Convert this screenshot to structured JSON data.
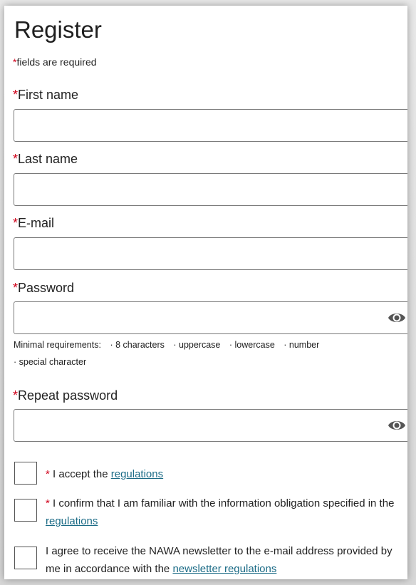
{
  "form": {
    "title": "Register",
    "required_star": "*",
    "required_note": "fields are required",
    "fields": {
      "first_name": {
        "label": "First name",
        "value": "",
        "placeholder": ""
      },
      "last_name": {
        "label": "Last name",
        "value": "",
        "placeholder": ""
      },
      "email": {
        "label": "E-mail",
        "value": "",
        "placeholder": ""
      },
      "password": {
        "label": "Password",
        "value": "",
        "placeholder": ""
      },
      "repeat_password": {
        "label": "Repeat password",
        "value": "",
        "placeholder": ""
      }
    },
    "password_requirements": {
      "intro": "Minimal requirements:",
      "items": [
        "· 8 characters",
        "· uppercase",
        "· lowercase",
        "· number",
        "· special character"
      ]
    },
    "checkboxes": {
      "regulations": {
        "checked": false,
        "text": "I accept the ",
        "link": "regulations"
      },
      "information": {
        "checked": false,
        "text": "I confirm that I am familiar with the information obligation specified in the ",
        "link": "regulations"
      },
      "newsletter": {
        "checked": false,
        "text": "I agree to receive the NAWA newsletter to the e-mail address provided by me in accordance with the ",
        "link": "newsletter regulations"
      }
    }
  },
  "icons": {
    "password_toggle": "eye-icon"
  },
  "colors": {
    "required": "#d0021b",
    "link": "#1b6b86",
    "border": "#7a7a7a"
  }
}
